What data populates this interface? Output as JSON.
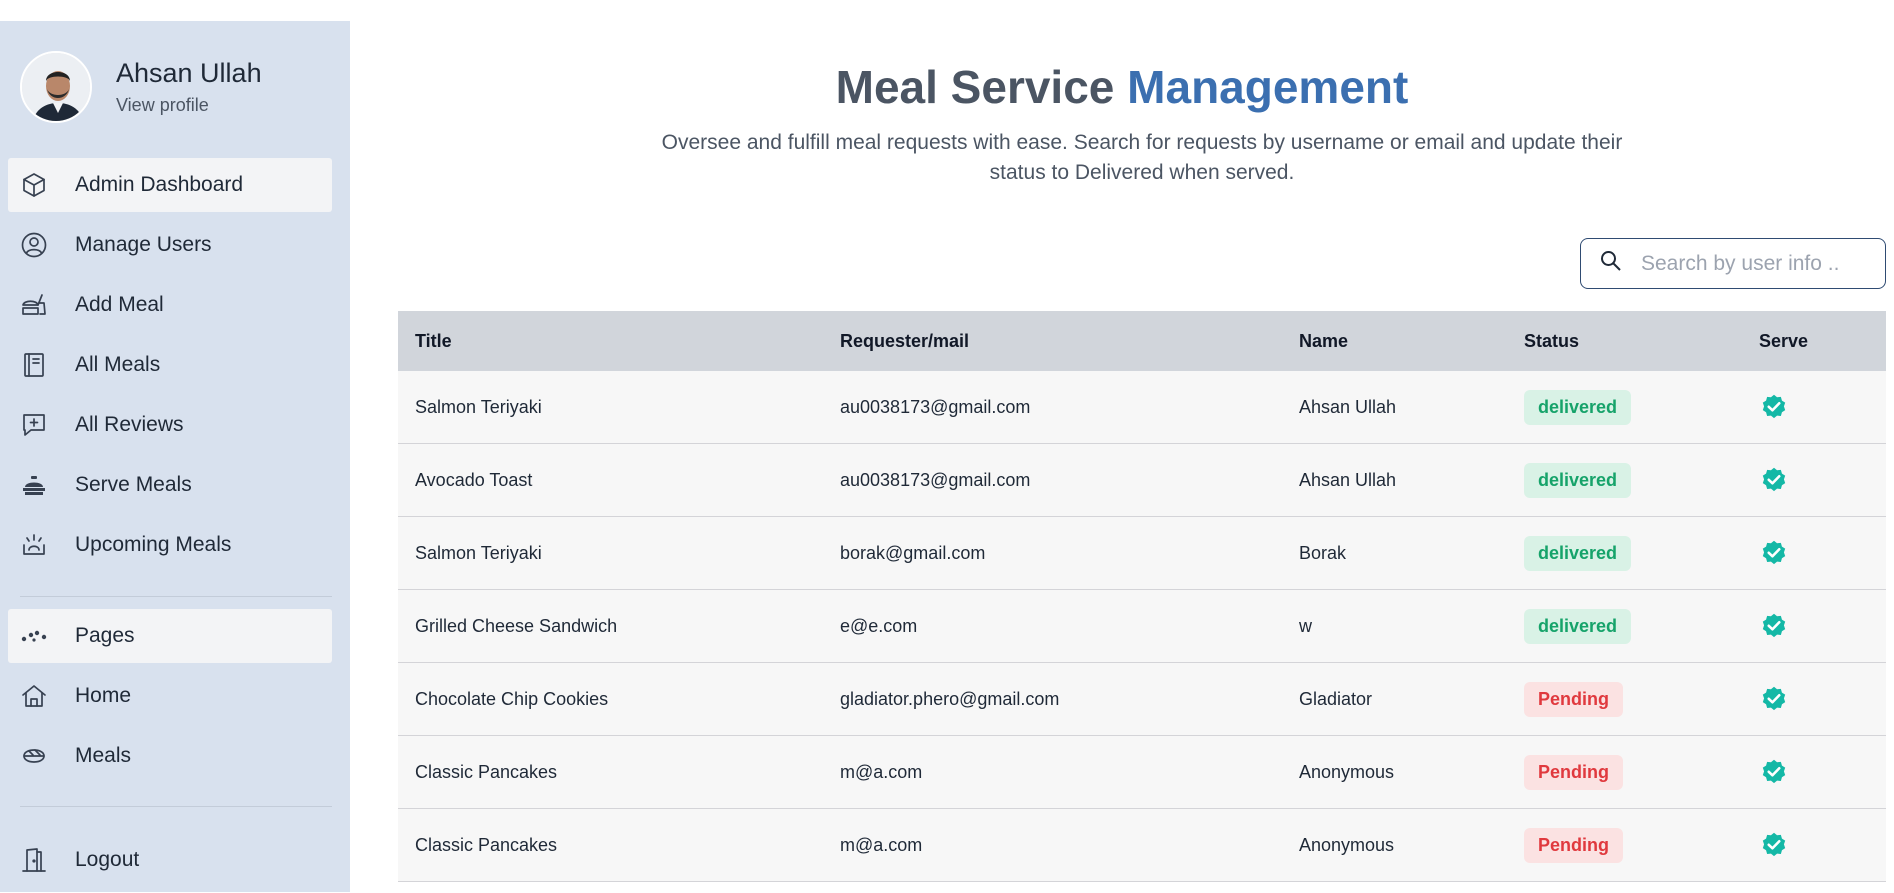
{
  "sidebar": {
    "profile": {
      "name": "Ahsan Ullah",
      "link": "View profile"
    },
    "items": [
      {
        "label": "Admin Dashboard",
        "icon": "hexagon-icon",
        "active": true
      },
      {
        "label": "Manage Users",
        "icon": "user-circle-icon",
        "active": false
      },
      {
        "label": "Add Meal",
        "icon": "food-add-icon",
        "active": false
      },
      {
        "label": "All Meals",
        "icon": "book-icon",
        "active": false
      },
      {
        "label": "All Reviews",
        "icon": "message-plus-icon",
        "active": false
      },
      {
        "label": "Serve Meals",
        "icon": "cloche-icon",
        "active": false
      },
      {
        "label": "Upcoming Meals",
        "icon": "sunrise-icon",
        "active": false
      }
    ],
    "pages": [
      {
        "label": "Pages",
        "icon": "dots-icon",
        "active": true
      },
      {
        "label": "Home",
        "icon": "home-icon",
        "active": false
      },
      {
        "label": "Meals",
        "icon": "bowl-icon",
        "active": false
      }
    ],
    "logout": {
      "label": "Logout",
      "icon": "door-icon"
    }
  },
  "main": {
    "title_part1": "Meal Service",
    "title_part2": "Management",
    "subtitle": "Oversee and fulfill meal requests with ease. Search for requests by username or email and update their status to Delivered when served.",
    "search": {
      "placeholder": "Search by user info ..",
      "value": ""
    }
  },
  "table": {
    "headers": [
      "Title",
      "Requester/mail",
      "Name",
      "Status",
      "Serve"
    ],
    "rows": [
      {
        "title": "Salmon Teriyaki",
        "mail": "au0038173@gmail.com",
        "name": "Ahsan Ullah",
        "status": "delivered"
      },
      {
        "title": "Avocado Toast",
        "mail": "au0038173@gmail.com",
        "name": "Ahsan Ullah",
        "status": "delivered"
      },
      {
        "title": "Salmon Teriyaki",
        "mail": "borak@gmail.com",
        "name": "Borak",
        "status": "delivered"
      },
      {
        "title": "Grilled Cheese Sandwich",
        "mail": "e@e.com",
        "name": "w",
        "status": "delivered"
      },
      {
        "title": "Chocolate Chip Cookies",
        "mail": "gladiator.phero@gmail.com",
        "name": "Gladiator",
        "status": "Pending"
      },
      {
        "title": "Classic Pancakes",
        "mail": "m@a.com",
        "name": "Anonymous",
        "status": "Pending"
      },
      {
        "title": "Classic Pancakes",
        "mail": "m@a.com",
        "name": "Anonymous",
        "status": "Pending"
      }
    ]
  },
  "colors": {
    "sidebar_bg": "#d8e1ee",
    "accent": "#3b6fb0",
    "delivered_text": "#16a36a",
    "pending_text": "#e0393e",
    "serve_check": "#14b8a6"
  }
}
